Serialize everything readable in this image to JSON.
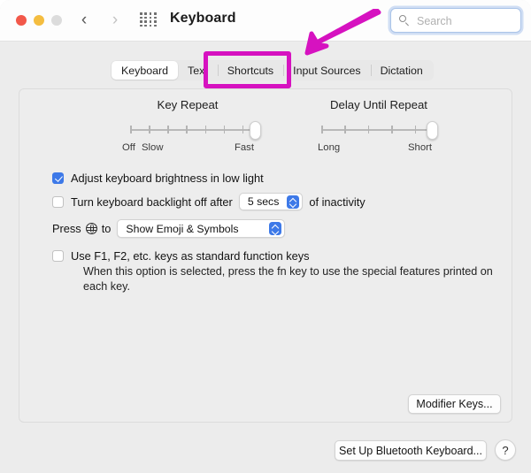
{
  "window": {
    "title": "Keyboard",
    "traffic_lights": [
      "close-red",
      "minimize-yellow",
      "zoom-gray"
    ],
    "nav": {
      "back": "‹",
      "forward": "›"
    },
    "grid_icon": "apps-grid-icon"
  },
  "search": {
    "placeholder": "Search",
    "value": "",
    "icon": "search-icon"
  },
  "tabs": [
    {
      "label": "Keyboard",
      "selected": true
    },
    {
      "label": "Text",
      "selected": false
    },
    {
      "label": "Shortcuts",
      "selected": false
    },
    {
      "label": "Input Sources",
      "selected": false
    },
    {
      "label": "Dictation",
      "selected": false
    }
  ],
  "sliders": {
    "key_repeat": {
      "title": "Key Repeat",
      "labels": {
        "min": "Off",
        "second": "Slow",
        "max": "Fast"
      },
      "ticks": 8,
      "value_position": "max"
    },
    "delay_until_repeat": {
      "title": "Delay Until Repeat",
      "labels": {
        "min": "Long",
        "max": "Short"
      },
      "ticks": 6,
      "value_position": "max"
    }
  },
  "options": {
    "adjust_brightness": {
      "label": "Adjust keyboard brightness in low light",
      "checked": true
    },
    "backlight_off": {
      "label_before": "Turn keyboard backlight off after",
      "value": "5 secs",
      "label_after": "of inactivity",
      "checked": false
    },
    "press_globe": {
      "label_before": "Press",
      "icon": "globe-icon",
      "label_mid": "to",
      "value": "Show Emoji & Symbols"
    },
    "function_keys": {
      "label": "Use F1, F2, etc. keys as standard function keys",
      "checked": false,
      "description": "When this option is selected, press the fn key to use the special features printed on each key."
    }
  },
  "buttons": {
    "modifier_keys": "Modifier Keys...",
    "bluetooth_keyboard": "Set Up Bluetooth Keyboard...",
    "help": "?"
  },
  "annotation": {
    "color": "#d612c0",
    "highlight_target": "Shortcuts",
    "arrow": "down-left-arrow"
  }
}
